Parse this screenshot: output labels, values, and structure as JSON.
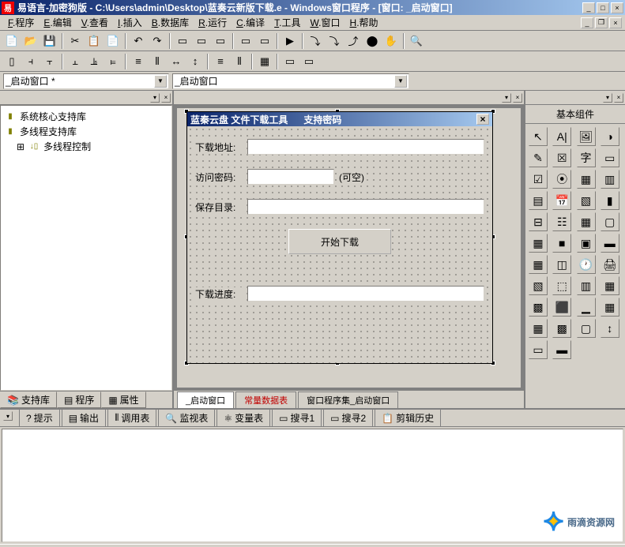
{
  "title": "易语言-加密狗版 - C:\\Users\\admin\\Desktop\\蓝奏云新版下载.e - Windows窗口程序 - [窗口: _启动窗口]",
  "app_icon": "易",
  "menu": {
    "file": "程序",
    "file_key": "F",
    "edit": "编辑",
    "edit_key": "E",
    "view": "查看",
    "view_key": "V",
    "insert": "插入",
    "insert_key": "I",
    "database": "数据库",
    "database_key": "B",
    "run": "运行",
    "run_key": "R",
    "compile": "编译",
    "compile_key": "C",
    "tools": "工具",
    "tools_key": "T",
    "window": "窗口",
    "window_key": "W",
    "help": "帮助",
    "help_key": "H"
  },
  "combos": {
    "left": "_启动窗口 *",
    "right": "_启动窗口"
  },
  "tree": {
    "item1": "系统核心支持库",
    "item2": "多线程支持库",
    "item3": "多线程控制",
    "expand": "⊞"
  },
  "left_tabs": {
    "t1": "支持库",
    "t2": "程序",
    "t3": "属性"
  },
  "form": {
    "title": "蓝秦云盘 文件下载工具",
    "title_suffix": "支持密码",
    "url_label": "下载地址:",
    "pwd_label": "访问密码:",
    "pwd_hint": "(可空)",
    "dir_label": "保存目录:",
    "start_btn": "开始下载",
    "progress_label": "下载进度:"
  },
  "center_tabs": {
    "t1": "_启动窗口",
    "t2": "常量数据表",
    "t3": "窗口程序集_启动窗口"
  },
  "palette_title": "基本组件",
  "palette_items": [
    "↖",
    "A|",
    "🖼",
    "◑",
    "✎",
    "☒",
    "字",
    "▭",
    "☑",
    "⦿",
    "▦",
    "▥",
    "▤",
    "📅",
    "▧",
    "▮",
    "⊟",
    "☷",
    "▦",
    "▢",
    "▦",
    "■",
    "▣",
    "▬",
    "▦",
    "◫",
    "🕐",
    "🖨",
    "▧",
    "⬚",
    "▥",
    "▦",
    "▩",
    "⬛",
    "▁",
    "▦",
    "▦",
    "▩",
    "▢",
    "↕",
    "▭",
    "▬"
  ],
  "bottom_tabs": {
    "t1": "提示",
    "t2": "输出",
    "t3": "调用表",
    "t4": "监视表",
    "t5": "变量表",
    "t6": "搜寻1",
    "t7": "搜寻2",
    "t8": "剪辑历史"
  },
  "watermark": "雨滴资源网"
}
